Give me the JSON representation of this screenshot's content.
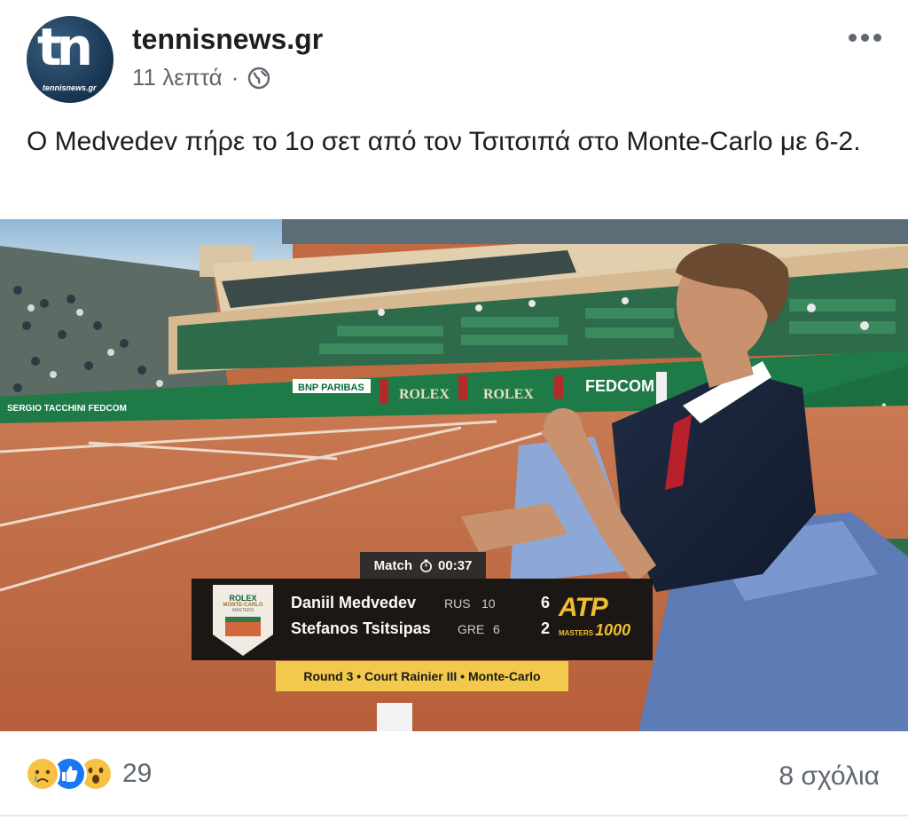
{
  "post": {
    "page_name": "tennisnews.gr",
    "avatar_text": "tn",
    "avatar_subtext": "tennisnews.gr",
    "time": "11 λεπτά",
    "separator": "·",
    "privacy_icon": "globe-icon",
    "text": "Ο Medvedev πήρε το 1ο σετ από τον Τσιτσιπά στο Monte-Carlo με 6-2."
  },
  "scorebug": {
    "match_label": "Match",
    "clock_icon": "stopwatch-icon",
    "time": "00:37",
    "tournament_logo": {
      "brand": "ROLEX",
      "event": "MONTE-CARLO",
      "level": "MASTERS"
    },
    "players": [
      {
        "name": "Daniil Medvedev",
        "country": "RUS",
        "seed": "10",
        "score": "6"
      },
      {
        "name": "Stefanos Tsitsipas",
        "country": "GRE",
        "seed": "6",
        "score": "2"
      }
    ],
    "atp_logo": {
      "main": "ATP",
      "sub": "MASTERS",
      "number": "1000"
    },
    "round_info": "Round 3 • Court Rainier III • Monte-Carlo"
  },
  "scene": {
    "banners": [
      "BNP PARIBAS",
      "ROLEX",
      "ROLEX",
      "FEDCOM",
      "SERGIO TACCHINI",
      "FEDCOM",
      "FEDCOM"
    ]
  },
  "footer": {
    "reactions": [
      "sad-reaction-icon",
      "like-reaction-icon",
      "wow-reaction-icon"
    ],
    "reaction_count": "29",
    "comments": "8 σχόλια"
  },
  "colors": {
    "text_primary": "#1c1e21",
    "text_secondary": "#606770",
    "like_blue": "#1877f2",
    "reaction_yellow": "#f7c244",
    "clay": "#c06a44",
    "wall_green": "#1e7a47",
    "scorebug_bg": "#141414",
    "round_bar": "#f2c94c"
  }
}
